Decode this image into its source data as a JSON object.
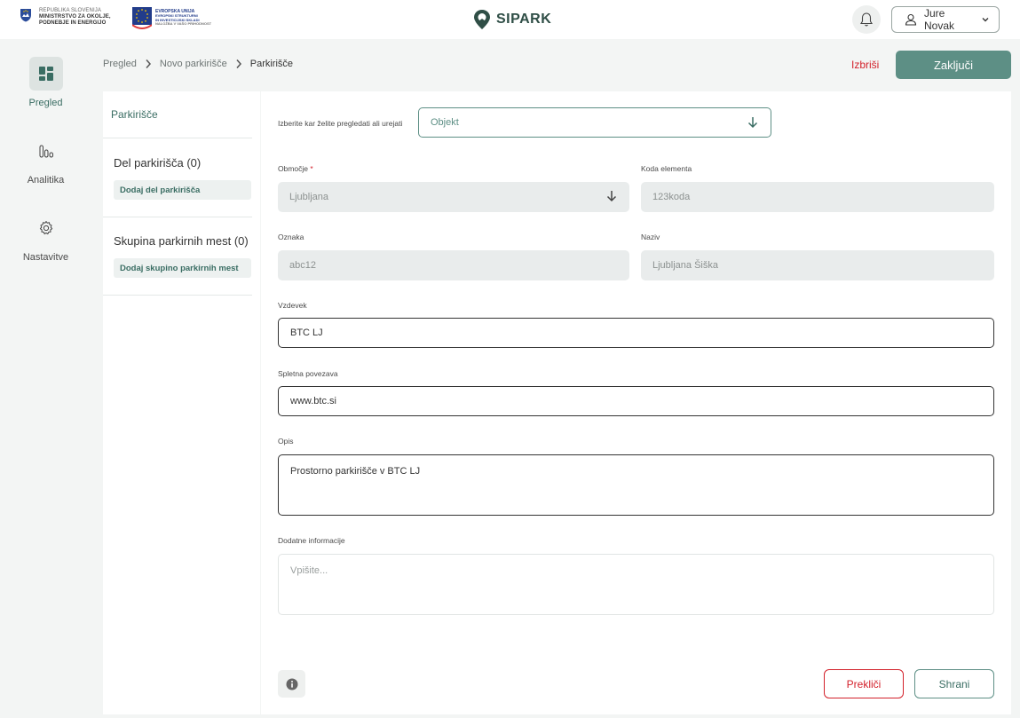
{
  "header": {
    "gov_logo": {
      "line1": "REPUBLIKA SLOVENIJA",
      "line2": "MINISTRSTVO ZA OKOLJE,",
      "line3": "PODNEBJE IN ENERGIJO"
    },
    "eu_logo": {
      "line1": "EVROPSKA UNIJA",
      "line2": "EVROPSKI STRUKTURNI",
      "line3": "IN INVESTICIJSKI SKLADI",
      "line4": "NALOŽBA V VAŠO PRIHODNOST"
    },
    "brand": "SIPARK",
    "user_name": "Jure Novak",
    "icons": [
      "slovenia-crest-icon",
      "eu-flag-icon",
      "sipark-logo-icon",
      "bell-icon",
      "user-icon",
      "chevron-down-icon"
    ]
  },
  "sidebar": {
    "items": [
      {
        "label": "Pregled",
        "icon": "dashboard-icon",
        "active": true
      },
      {
        "label": "Analitika",
        "icon": "bar-chart-icon",
        "active": false
      },
      {
        "label": "Nastavitve",
        "icon": "gear-icon",
        "active": false
      }
    ]
  },
  "breadcrumb": {
    "items": [
      "Pregled",
      "Novo parkirišče",
      "Parkirišče"
    ]
  },
  "actions": {
    "delete": "Izbriši",
    "finish": "Zaključi"
  },
  "left_panel": {
    "title": "Parkirišče",
    "sections": [
      {
        "title": "Del parkirišča (0)",
        "add_label": "Dodaj del parkirišča"
      },
      {
        "title": "Skupina parkirnih mest (0)",
        "add_label": "Dodaj skupino parkirnih mest"
      }
    ]
  },
  "form": {
    "selector": {
      "label": "Izberite kar želite pregledati ali urejati",
      "value": "Objekt"
    },
    "obmocje": {
      "label": "Območje",
      "required_mark": "*",
      "value": "Ljubljana"
    },
    "koda": {
      "label": "Koda elementa",
      "value": "123koda"
    },
    "oznaka": {
      "label": "Oznaka",
      "value": "abc12"
    },
    "naziv": {
      "label": "Naziv",
      "value": "Ljubljana Šiška"
    },
    "vzdevek": {
      "label": "Vzdevek",
      "value": "BTC LJ"
    },
    "povezava": {
      "label": "Spletna povezava",
      "value": "www.btc.si"
    },
    "opis": {
      "label": "Opis",
      "value": "Prostorno parkirišče v BTC LJ"
    },
    "dodatne": {
      "label": "Dodatne informacije",
      "placeholder": "Vpišite..."
    }
  },
  "footer": {
    "cancel": "Prekliči",
    "save": "Shrani",
    "info_icon": "info-icon"
  },
  "colors": {
    "accent": "#5d8f85",
    "brand_dark": "#2f4e46",
    "danger": "#d3212b",
    "background": "#f3f5f4"
  }
}
